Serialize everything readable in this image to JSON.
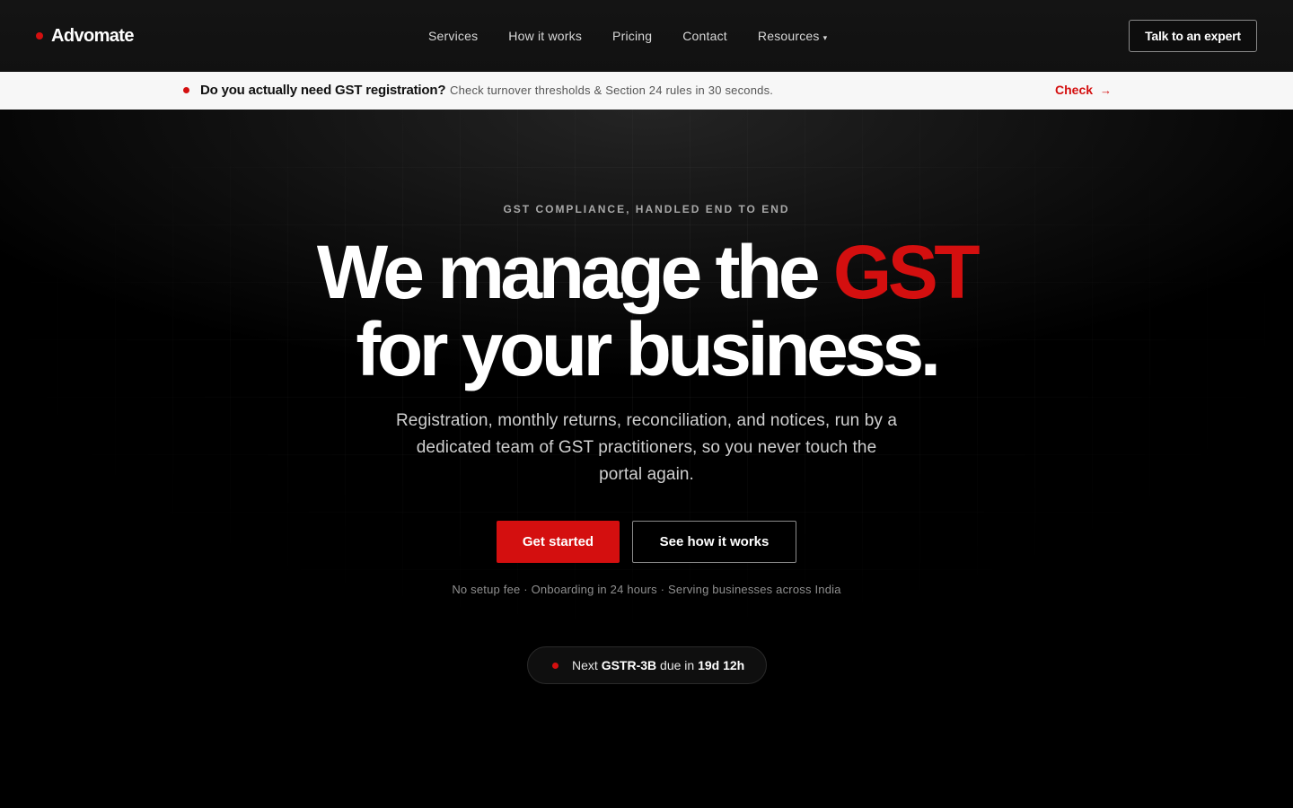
{
  "header": {
    "brand": "Advomate",
    "nav": [
      {
        "label": "Services"
      },
      {
        "label": "How it works"
      },
      {
        "label": "Pricing"
      },
      {
        "label": "Contact"
      },
      {
        "label": "Resources"
      }
    ],
    "cta_label": "Talk to an expert"
  },
  "banner": {
    "question": "Do you actually need GST registration?",
    "subtext": "Check turnover thresholds & Section 24 rules in 30 seconds.",
    "link_label": "Check",
    "link_arrow": "→"
  },
  "hero": {
    "eyebrow": "GST COMPLIANCE, HANDLED END TO END",
    "headline_part1": "We manage the ",
    "headline_accent": "GST",
    "headline_line2": "for your business.",
    "subcopy": "Registration, monthly returns, reconciliation, and notices, run by a dedicated team of GST practitioners, so you never touch the portal again.",
    "primary_button": "Get started",
    "secondary_button": "See how it works",
    "trust_line": "No setup fee · Onboarding in 24 hours · Serving businesses across India",
    "due": {
      "prefix": "Next ",
      "form": "GSTR-3B",
      "middle": " due in ",
      "countdown": "19d 12h"
    }
  },
  "colors": {
    "accent": "#d40f0f",
    "background": "#000000",
    "banner_bg": "#f7f7f7"
  }
}
